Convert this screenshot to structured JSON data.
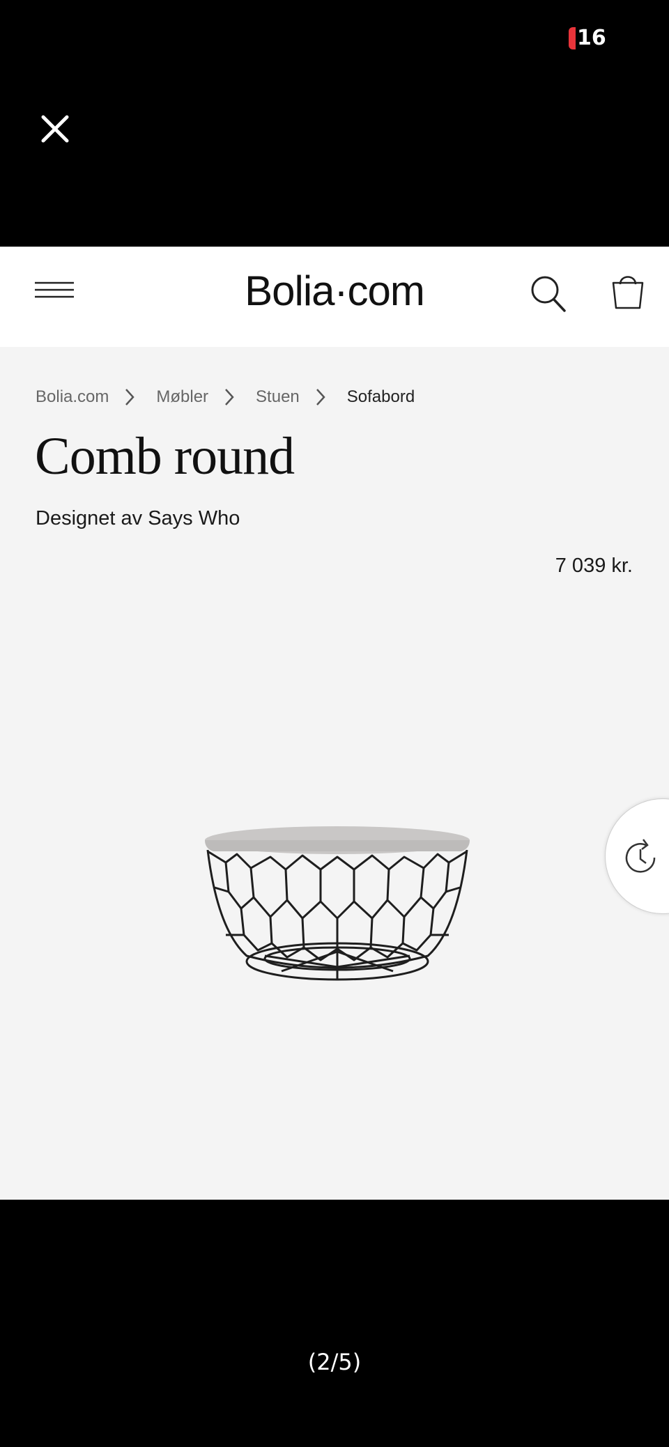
{
  "status_bar": {
    "battery_level": "16",
    "battery_color": "#e8343a"
  },
  "viewer": {
    "close_icon": "close-icon",
    "page_indicator": "(2/5)"
  },
  "site": {
    "logo_text": "Bolia·com",
    "menu_icon": "hamburger-menu-icon",
    "search_icon": "search-icon",
    "cart_icon": "shopping-bag-icon"
  },
  "breadcrumb": [
    {
      "label": "Bolia.com"
    },
    {
      "label": "Møbler"
    },
    {
      "label": "Stuen"
    },
    {
      "label": "Sofabord"
    }
  ],
  "product": {
    "title": "Comb round",
    "designer": "Designet av Says Who",
    "price": "7 039 kr.",
    "image_icon": "coffee-table-image"
  },
  "floating_button": {
    "icon": "history-icon"
  },
  "colors": {
    "page_background": "#f4f4f4",
    "header_background": "#ffffff",
    "frame_background": "#000000",
    "text_primary": "#111111",
    "text_muted": "#666666"
  }
}
